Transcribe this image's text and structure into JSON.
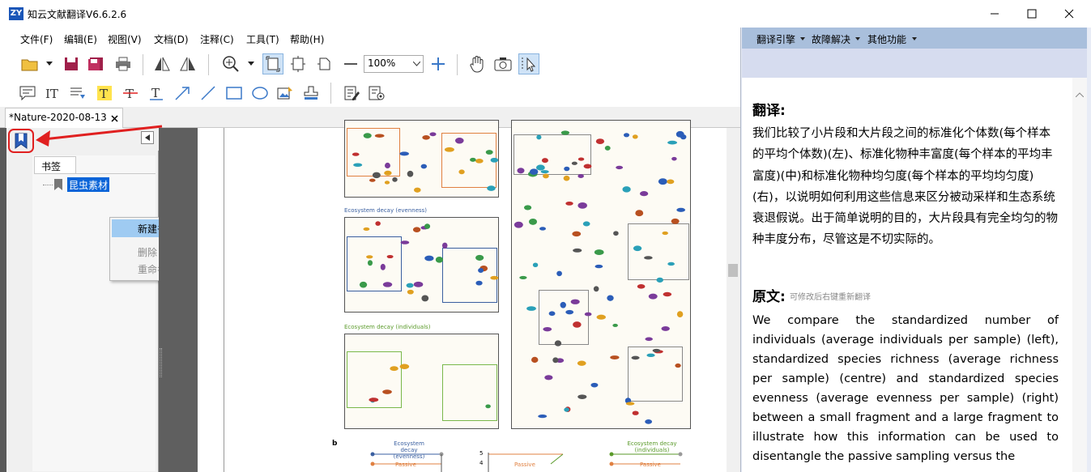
{
  "window": {
    "title": "知云文献翻译V6.6.2.6",
    "icon_text": "ZY",
    "controls": [
      "minimize-icon",
      "maximize-icon",
      "close-icon"
    ]
  },
  "menu": {
    "items": [
      "文件(F)",
      "编辑(E)",
      "视图(V)",
      "文档(D)",
      "注释(C)",
      "工具(T)",
      "帮助(H)"
    ]
  },
  "toolbar": {
    "zoom_value": "100%"
  },
  "tabs": [
    {
      "label": "*Nature-2020-08-13"
    }
  ],
  "bookmarks": {
    "tab_label": "书签",
    "items": [
      {
        "label": "昆虫素材"
      }
    ]
  },
  "context_menu": {
    "items": [
      {
        "label": "新建书签",
        "enabled": true
      },
      {
        "label": "删除",
        "enabled": false
      },
      {
        "label": "重命名",
        "enabled": false
      }
    ]
  },
  "document": {
    "captions": [
      "Ecosystem decay (evenness)",
      "Ecosystem decay (individuals)"
    ],
    "panel_b_label": "b",
    "mini_captions": [
      "Ecosystem decay (evenness)",
      "Ecosystem decay (individuals)"
    ],
    "passive_label": "Passive",
    "tick_labels": [
      "5",
      "4"
    ]
  },
  "right_panel": {
    "menus": [
      "翻译引擎",
      "故障解决",
      "其他功能"
    ],
    "translation_title": "翻译:",
    "translation_text": "我们比较了小片段和大片段之间的标准化个体数(每个样本的平均个体数)(左)、标准化物种丰富度(每个样本的平均丰富度)(中)和标准化物种均匀度(每个样本的平均均匀度)(右)，以说明如何利用这些信息来区分被动采样和生态系统衰退假说。出于简单说明的目的，大片段具有完全均匀的物种丰度分布，尽管这是不切实际的。",
    "source_title": "原文:",
    "source_hint": "可修改后右键重新翻译",
    "source_text": "We compare the standardized number of individuals (average individuals per sample) (left), standardized species richness (average richness per sample) (centre) and standardized species evenness (average evenness per sample) (right) between a small fragment and a large fragment to illustrate how this information can be used to disentangle the passive sampling versus the"
  },
  "colors": {
    "accent_blue": "#0a64d8",
    "highlight_red": "#e02020",
    "panel_blue": "#a9bfdc"
  }
}
